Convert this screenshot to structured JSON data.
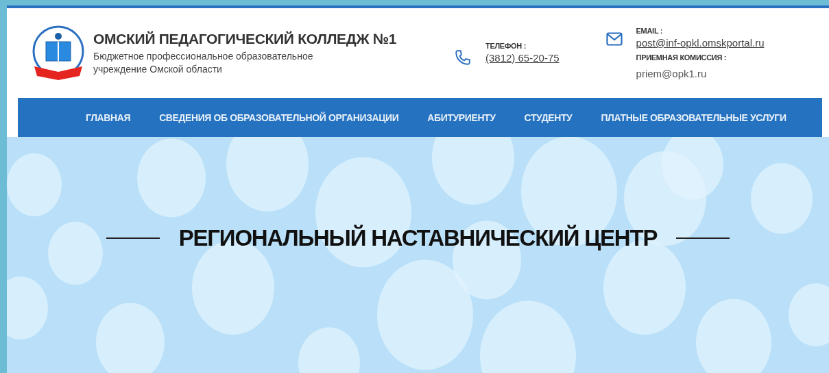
{
  "header": {
    "title": "ОМСКИЙ ПЕДАГОГИЧЕСКИЙ КОЛЛЕДЖ №1",
    "subtitle": [
      "Бюджетное профессиональное образовательное",
      "учреждение Омской области"
    ],
    "phone": {
      "label": "ТЕЛЕФОН :",
      "value": "(3812) 65-20-75"
    },
    "email": {
      "label": "EMAIL :",
      "value": "post@inf-opkl.omskportal.ru",
      "admissions_label": "ПРИЕМНАЯ КОМИССИЯ :",
      "admissions_value": "priem@opk1.ru"
    }
  },
  "nav": {
    "items": [
      {
        "label": "ГЛАВНАЯ"
      },
      {
        "label": "СВЕДЕНИЯ ОБ ОБРАЗОВАТЕЛЬНОЙ ОРГАНИЗАЦИИ"
      },
      {
        "label": "АБИТУРИЕНТУ"
      },
      {
        "label": "СТУДЕНТУ"
      },
      {
        "label": "ПЛАТНЫЕ ОБРАЗОВАТЕЛЬНЫЕ УСЛУГИ"
      }
    ]
  },
  "hero": {
    "title": "РЕГИОНАЛЬНЫЙ НАСТАВНИЧЕСКИЙ ЦЕНТР"
  }
}
